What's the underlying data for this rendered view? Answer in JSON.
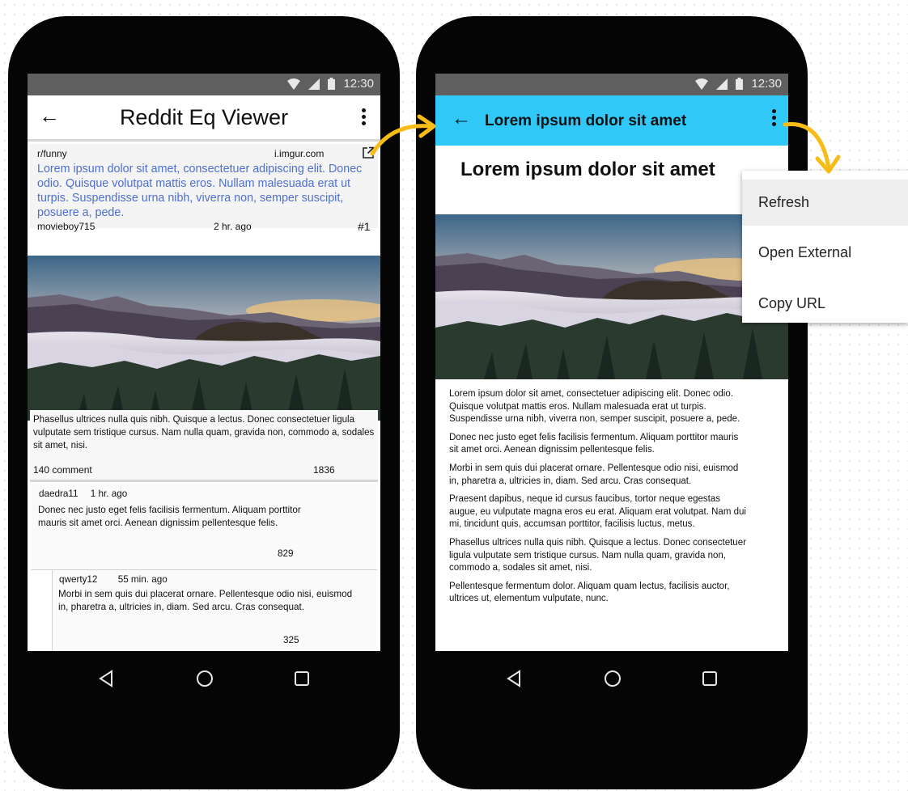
{
  "status": {
    "time": "12:30"
  },
  "left_phone": {
    "app_title": "Reddit Eq Viewer",
    "post": {
      "subreddit": "r/funny",
      "domain": "i.imgur.com",
      "title": "Lorem ipsum dolor sit amet, consectetuer adipiscing elit. Donec odio. Quisque volutpat mattis eros. Nullam malesuada erat ut turpis. Suspendisse urna nibh, viverra non, semper suscipit, posuere a, pede.",
      "author": "movieboy715",
      "time": "2 hr. ago",
      "rank": "#1",
      "body": "Phasellus ultrices nulla quis nibh. Quisque a lectus. Donec consectetuer ligula vulputate sem tristique cursus. Nam nulla quam, gravida non, commodo a, sodales sit amet, nisi.",
      "comments": "140 comment",
      "score": "1836"
    },
    "comments": [
      {
        "author": "daedra11",
        "time": "1 hr. ago",
        "text": "Donec nec justo eget felis facilisis fermentum. Aliquam porttitor mauris sit amet orci. Aenean dignissim pellentesque felis.",
        "score": "829"
      },
      {
        "author": "qwerty12",
        "time": "55 min. ago",
        "text": "Morbi in sem quis dui placerat ornare. Pellentesque odio nisi, euismod in, pharetra a, ultricies in, diam. Sed arcu. Cras consequat.",
        "score": "325"
      }
    ]
  },
  "right_phone": {
    "app_title": "Lorem ipsum dolor sit amet",
    "heading": "Lorem ipsum dolor sit amet",
    "paragraphs": [
      "Lorem ipsum dolor sit amet, consectetuer adipiscing elit. Donec odio. Quisque volutpat mattis eros. Nullam malesuada erat ut turpis. Suspendisse urna nibh, viverra non, semper suscipit, posuere a, pede.",
      "Donec nec justo eget felis facilisis fermentum. Aliquam porttitor mauris sit amet orci. Aenean dignissim pellentesque felis.",
      "Morbi in sem quis dui placerat ornare. Pellentesque odio nisi, euismod in, pharetra a, ultricies in, diam. Sed arcu. Cras consequat.",
      "Praesent dapibus, neque id cursus faucibus, tortor neque egestas augue, eu vulputate magna eros eu erat. Aliquam erat volutpat. Nam dui mi, tincidunt quis, accumsan porttitor, facilisis luctus, metus.",
      "Phasellus ultrices nulla quis nibh. Quisque a lectus. Donec consectetuer ligula vulputate sem tristique cursus. Nam nulla quam, gravida non, commodo a, sodales sit amet, nisi.",
      "Pellentesque fermentum dolor. Aliquam quam lectus, facilisis auctor, ultrices ut, elementum vulputate, nunc."
    ],
    "menu": [
      "Refresh",
      "Open External",
      "Copy URL"
    ]
  },
  "icons": {
    "back": "arrow-left-icon",
    "overflow": "more-vert-icon",
    "external": "open-external-icon",
    "nav": [
      "back-triangle-icon",
      "home-circle-icon",
      "recents-square-icon"
    ]
  },
  "colors": {
    "link_title": "#4e6fce",
    "toolbar_blue": "#2fc8f7",
    "annotation_arrow": "#f7bd16"
  }
}
